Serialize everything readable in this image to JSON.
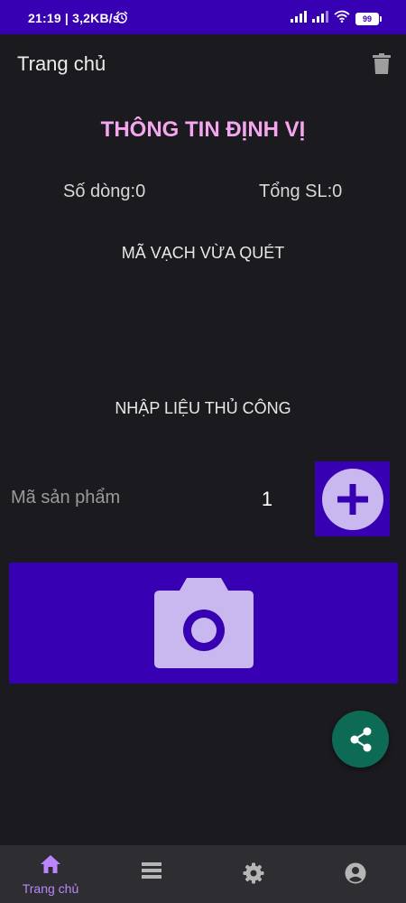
{
  "status_bar": {
    "time_speed": "21:19 | 3,2KB/s",
    "battery": "99"
  },
  "app_bar": {
    "title": "Trang chủ",
    "delete_icon": "trash-icon"
  },
  "location_info": {
    "title": "THÔNG TIN ĐỊNH VỊ",
    "row_count": "Số dòng:0",
    "total_qty": "Tổng SL:0",
    "last_scanned_label": "MÃ VẠCH VỪA QUÉT",
    "last_scanned_value": ""
  },
  "manual": {
    "label": "NHẬP LIỆU THỦ CÔNG",
    "product_placeholder": "Mã sản phẩm",
    "product_value": "",
    "quantity": "1",
    "add_icon": "plus-circle-icon"
  },
  "camera": {
    "icon": "camera-icon"
  },
  "share": {
    "icon": "share-icon"
  },
  "bottom_nav": {
    "items": [
      {
        "label": "Trang chủ",
        "icon": "home-icon",
        "active": true
      },
      {
        "label": "",
        "icon": "list-icon",
        "active": false
      },
      {
        "label": "",
        "icon": "gear-icon",
        "active": false
      },
      {
        "label": "",
        "icon": "account-icon",
        "active": false
      }
    ]
  },
  "colors": {
    "primary": "#3700b3",
    "accent": "#bb86fc",
    "title_pink": "#f4a7ee",
    "fab_green": "#0d6b55",
    "background": "#1b1a1f"
  }
}
